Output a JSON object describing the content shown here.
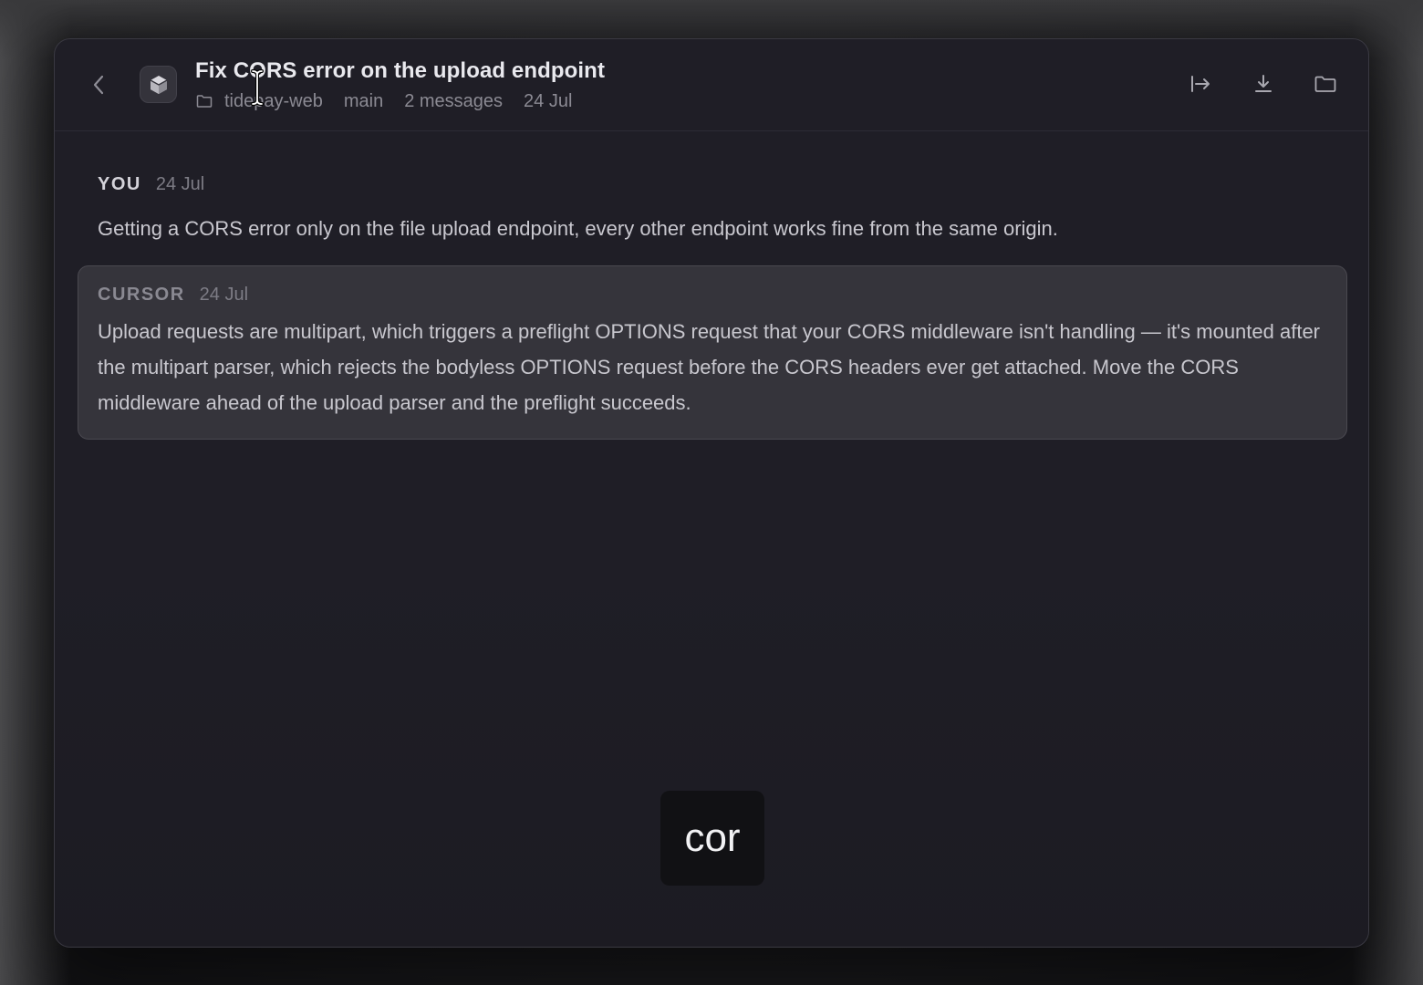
{
  "header": {
    "title": "Fix CORS error on the upload endpoint",
    "meta": {
      "project": "tidepay-web",
      "branch": "main",
      "message_count": "2 messages",
      "date": "24 Jul"
    },
    "icons": {
      "back": "chevron-left-icon",
      "app": "cube-icon",
      "folder_mini": "folder-icon",
      "share": "export-arrow-icon",
      "download": "download-icon",
      "folder": "folder-icon"
    }
  },
  "messages": [
    {
      "sender": "YOU",
      "date": "24 Jul",
      "text": "Getting a CORS error only on the file upload endpoint, every other endpoint works fine from the same origin."
    },
    {
      "sender": "CURSOR",
      "date": "24 Jul",
      "text": "Upload requests are multipart, which triggers a preflight OPTIONS request that your CORS middleware isn't handling — it's mounted after the multipart parser, which rejects the bodyless OPTIONS request before the CORS headers ever get attached. Move the CORS middleware ahead of the upload parser and the preflight succeeds."
    }
  ],
  "search_chip": {
    "text": "cor"
  }
}
